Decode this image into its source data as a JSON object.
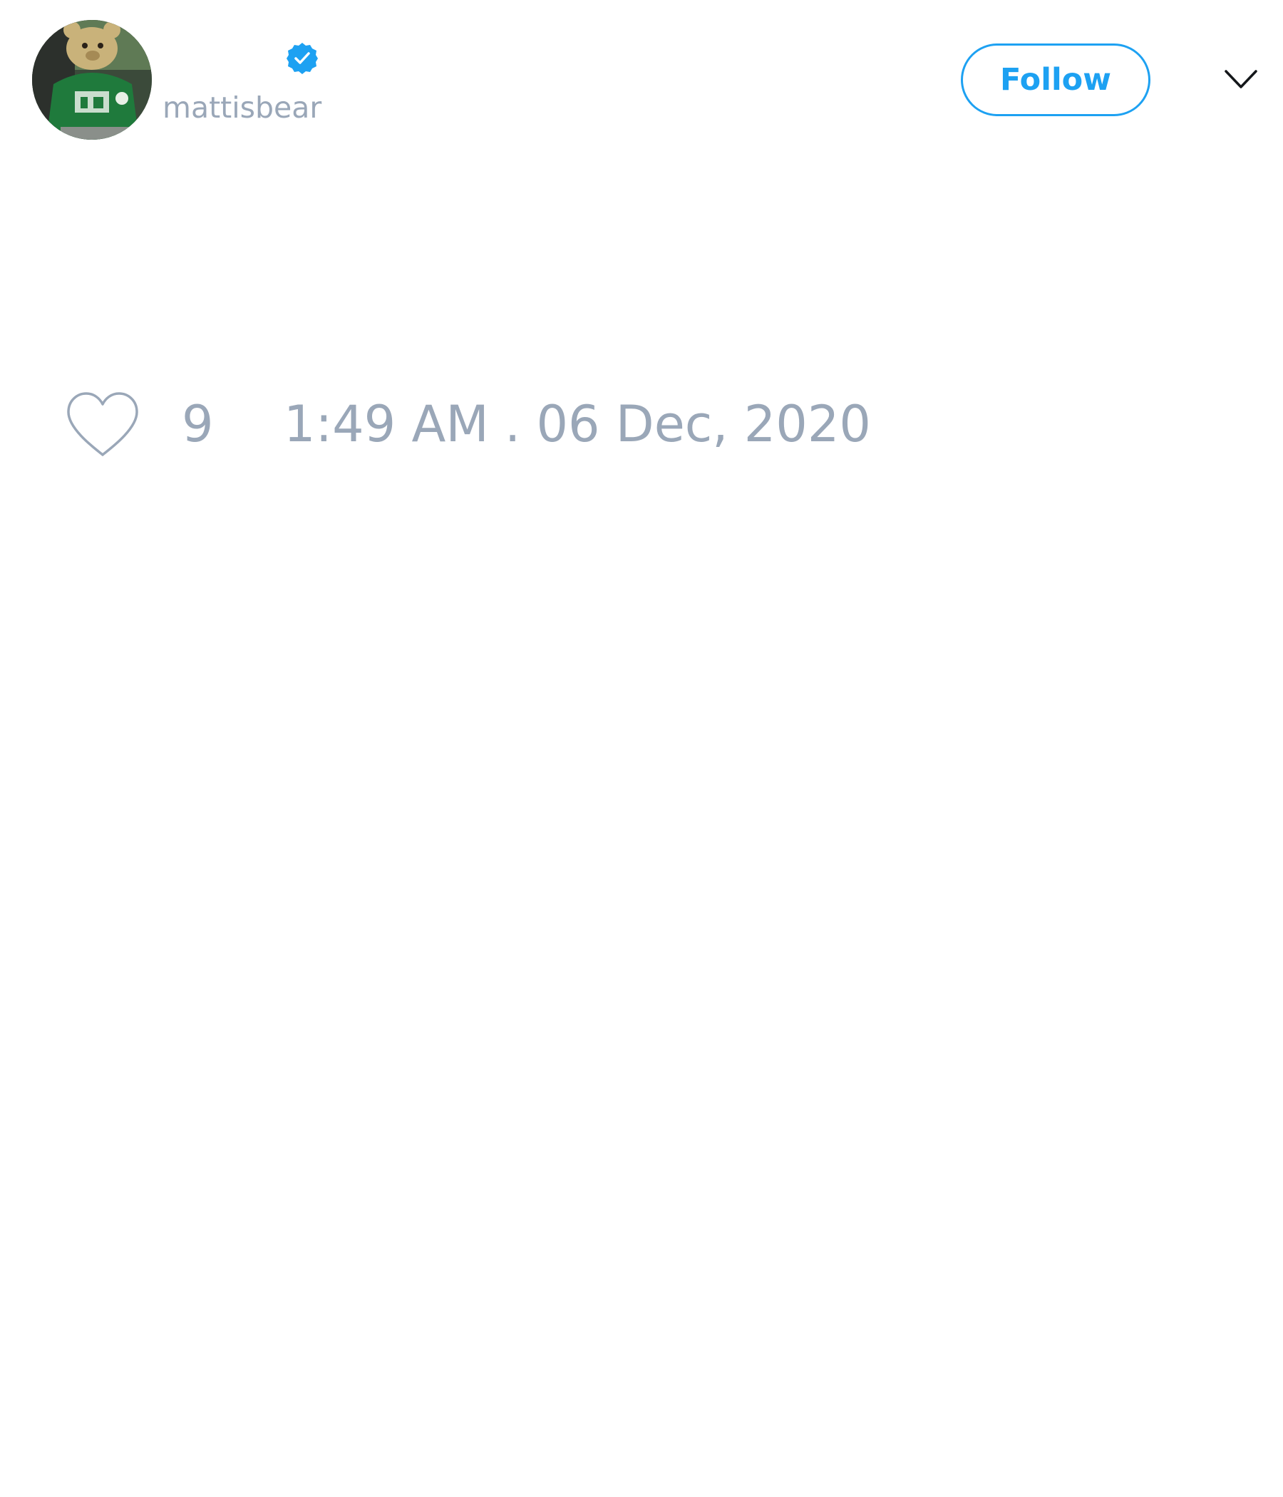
{
  "tweet": {
    "author": {
      "display_name": "",
      "handle": "mattisbear",
      "verified": true,
      "avatar_icon": "teddy-bear-avatar"
    },
    "follow_label": "Follow",
    "menu_icon": "chevron-down-icon",
    "likes": {
      "icon": "heart-outline-icon",
      "count": "9"
    },
    "timestamp": "1:49 AM . 06 Dec, 2020"
  },
  "colors": {
    "accent": "#1da1f2",
    "muted_text": "#9aa7b8",
    "background": "#ffffff"
  }
}
